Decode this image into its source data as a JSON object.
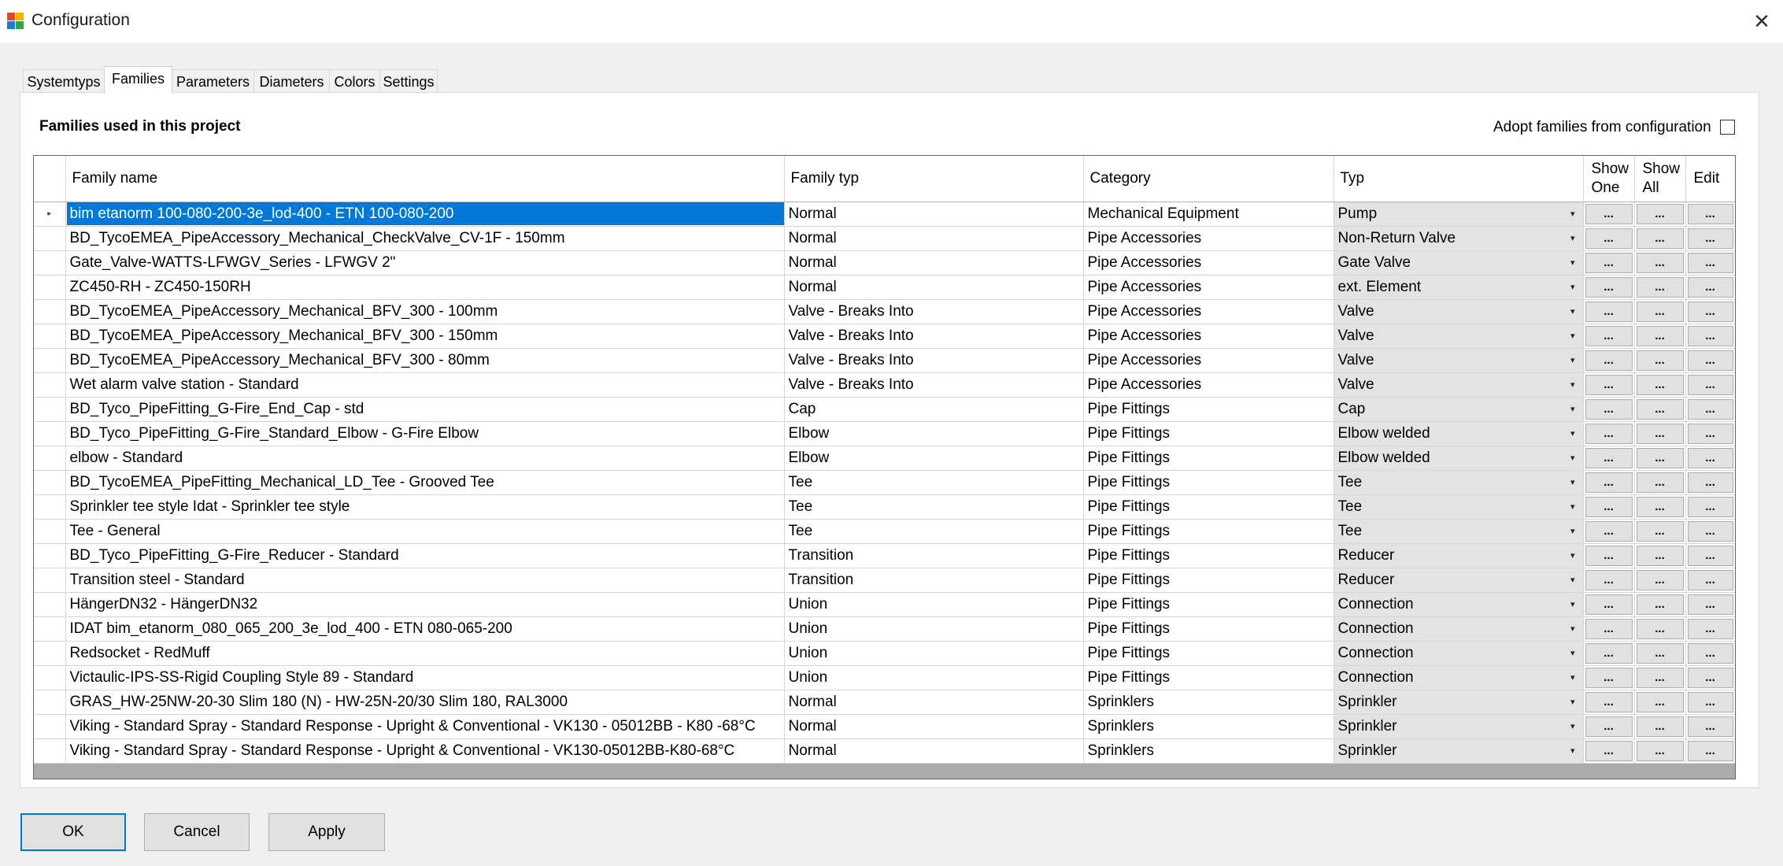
{
  "window": {
    "title": "Configuration"
  },
  "tabs": [
    "Systemtyps",
    "Families",
    "Parameters",
    "Diameters",
    "Colors",
    "Settings"
  ],
  "active_tab": "Families",
  "section_title": "Families used in this project",
  "adopt": {
    "label": "Adopt families from configuration",
    "checked": false
  },
  "grid": {
    "columns": {
      "family_name": "Family name",
      "family_typ": "Family typ",
      "category": "Category",
      "typ": "Typ",
      "show_one_1": "Show",
      "show_one_2": "One",
      "show_all_1": "Show",
      "show_all_2": "All",
      "edit": "Edit"
    },
    "button_text": "...",
    "current_row_marker": "▸",
    "dropdown_arrow": "▾",
    "rows": [
      {
        "name": "bim etanorm 100-080-200-3e_lod-400 - ETN 100-080-200",
        "family_typ": "Normal",
        "category": "Mechanical Equipment",
        "typ": "Pump"
      },
      {
        "name": "BD_TycoEMEA_PipeAccessory_Mechanical_CheckValve_CV-1F - 150mm",
        "family_typ": "Normal",
        "category": "Pipe Accessories",
        "typ": "Non-Return Valve"
      },
      {
        "name": "Gate_Valve-WATTS-LFWGV_Series - LFWGV 2\"",
        "family_typ": "Normal",
        "category": "Pipe Accessories",
        "typ": "Gate Valve"
      },
      {
        "name": "ZC450-RH - ZC450-150RH",
        "family_typ": "Normal",
        "category": "Pipe Accessories",
        "typ": "ext. Element"
      },
      {
        "name": "BD_TycoEMEA_PipeAccessory_Mechanical_BFV_300 - 100mm",
        "family_typ": "Valve - Breaks Into",
        "category": "Pipe Accessories",
        "typ": "Valve"
      },
      {
        "name": "BD_TycoEMEA_PipeAccessory_Mechanical_BFV_300 - 150mm",
        "family_typ": "Valve - Breaks Into",
        "category": "Pipe Accessories",
        "typ": "Valve"
      },
      {
        "name": "BD_TycoEMEA_PipeAccessory_Mechanical_BFV_300 - 80mm",
        "family_typ": "Valve - Breaks Into",
        "category": "Pipe Accessories",
        "typ": "Valve"
      },
      {
        "name": "Wet alarm valve station - Standard",
        "family_typ": "Valve - Breaks Into",
        "category": "Pipe Accessories",
        "typ": "Valve"
      },
      {
        "name": "BD_Tyco_PipeFitting_G-Fire_End_Cap - std",
        "family_typ": "Cap",
        "category": "Pipe Fittings",
        "typ": "Cap"
      },
      {
        "name": "BD_Tyco_PipeFitting_G-Fire_Standard_Elbow - G-Fire Elbow",
        "family_typ": "Elbow",
        "category": "Pipe Fittings",
        "typ": "Elbow welded"
      },
      {
        "name": "elbow - Standard",
        "family_typ": "Elbow",
        "category": "Pipe Fittings",
        "typ": "Elbow welded"
      },
      {
        "name": "BD_TycoEMEA_PipeFitting_Mechanical_LD_Tee - Grooved Tee",
        "family_typ": "Tee",
        "category": "Pipe Fittings",
        "typ": "Tee"
      },
      {
        "name": "Sprinkler tee style Idat - Sprinkler tee style",
        "family_typ": "Tee",
        "category": "Pipe Fittings",
        "typ": "Tee"
      },
      {
        "name": "Tee - General",
        "family_typ": "Tee",
        "category": "Pipe Fittings",
        "typ": "Tee"
      },
      {
        "name": "BD_Tyco_PipeFitting_G-Fire_Reducer - Standard",
        "family_typ": "Transition",
        "category": "Pipe Fittings",
        "typ": "Reducer"
      },
      {
        "name": "Transition steel - Standard",
        "family_typ": "Transition",
        "category": "Pipe Fittings",
        "typ": "Reducer"
      },
      {
        "name": "HängerDN32 - HängerDN32",
        "family_typ": "Union",
        "category": "Pipe Fittings",
        "typ": "Connection"
      },
      {
        "name": "IDAT bim_etanorm_080_065_200_3e_lod_400 - ETN 080-065-200",
        "family_typ": "Union",
        "category": "Pipe Fittings",
        "typ": "Connection"
      },
      {
        "name": "Redsocket - RedMuff",
        "family_typ": "Union",
        "category": "Pipe Fittings",
        "typ": "Connection"
      },
      {
        "name": "Victaulic-IPS-SS-Rigid Coupling Style 89 - Standard",
        "family_typ": "Union",
        "category": "Pipe Fittings",
        "typ": "Connection"
      },
      {
        "name": "GRAS_HW-25NW-20-30 Slim 180 (N) - HW-25N-20/30 Slim 180, RAL3000",
        "family_typ": "Normal",
        "category": "Sprinklers",
        "typ": "Sprinkler"
      },
      {
        "name": "Viking - Standard Spray - Standard Response - Upright & Conventional - VK130 - 05012BB - K80 -68°C",
        "family_typ": "Normal",
        "category": "Sprinklers",
        "typ": "Sprinkler"
      },
      {
        "name": "Viking - Standard Spray - Standard Response - Upright & Conventional - VK130-05012BB-K80-68°C",
        "family_typ": "Normal",
        "category": "Sprinklers",
        "typ": "Sprinkler"
      }
    ]
  },
  "buttons": {
    "ok": "OK",
    "cancel": "Cancel",
    "apply": "Apply"
  },
  "colors": {
    "selection": "#0078d7",
    "app_icon": [
      "#e8432c",
      "#f5b400",
      "#1c7bd4",
      "#2aa84a"
    ]
  }
}
